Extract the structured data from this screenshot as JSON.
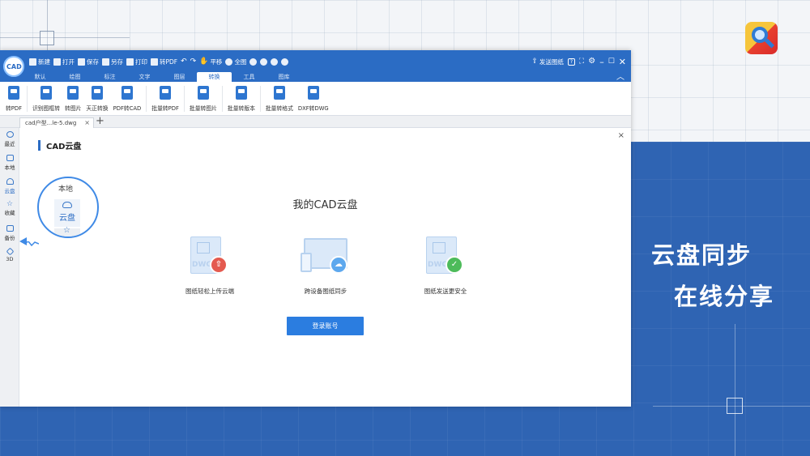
{
  "promo": {
    "line1": "云盘同步",
    "line2": "在线分享"
  },
  "app": {
    "logo_text": "CAD",
    "quick_tools": [
      {
        "icon": "new-file-icon",
        "label": "新建"
      },
      {
        "icon": "open-folder-icon",
        "label": "打开"
      },
      {
        "icon": "save-icon",
        "label": "保存"
      },
      {
        "icon": "save-as-icon",
        "label": "另存"
      },
      {
        "icon": "print-icon",
        "label": "打印"
      },
      {
        "icon": "to-pdf-icon",
        "label": "转PDF"
      },
      {
        "icon": "undo-icon",
        "label": ""
      },
      {
        "icon": "redo-icon",
        "label": ""
      },
      {
        "icon": "pan-hand-icon",
        "label": "平移"
      },
      {
        "icon": "fit-all-icon",
        "label": "全图"
      },
      {
        "icon": "zoom-in-icon",
        "label": ""
      },
      {
        "icon": "zoom-out-icon",
        "label": ""
      },
      {
        "icon": "zoom-window-icon",
        "label": ""
      },
      {
        "icon": "zoom-prev-icon",
        "label": ""
      }
    ],
    "send_drawing_label": "发送图纸",
    "tabs": [
      "默认",
      "绘图",
      "标注",
      "文字",
      "图层",
      "转换",
      "工具",
      "图库"
    ],
    "active_tab": "转换",
    "ribbon": [
      {
        "label": "转PDF",
        "icon": "pdf-export-icon"
      },
      {
        "label": "识别图框转",
        "icon": "frame-detect-icon"
      },
      {
        "label": "转图片",
        "icon": "image-export-icon"
      },
      {
        "label": "天正转换",
        "icon": "tangent-convert-icon"
      },
      {
        "label": "PDF转CAD",
        "icon": "pdf-to-cad-icon"
      },
      {
        "label": "批量转PDF",
        "icon": "batch-pdf-icon"
      },
      {
        "label": "批量转图片",
        "icon": "batch-image-icon"
      },
      {
        "label": "批量转版本",
        "icon": "batch-version-icon"
      },
      {
        "label": "批量转格式",
        "icon": "batch-format-icon"
      },
      {
        "label": "DXF转DWG",
        "icon": "dxf-to-dwg-icon"
      }
    ],
    "doc_tab": "cad户型...le-5.dwg",
    "doc_tab_close": "×",
    "add_tab": "+",
    "sidebar": [
      {
        "label": "最近",
        "icon": "recent-clock-icon"
      },
      {
        "label": "本地",
        "icon": "local-monitor-icon"
      },
      {
        "label": "云盘",
        "icon": "cloud-icon"
      },
      {
        "label": "收藏",
        "icon": "star-icon"
      },
      {
        "label": "备份",
        "icon": "backup-icon"
      },
      {
        "label": "3D",
        "icon": "cube-3d-icon"
      }
    ],
    "panel": {
      "close": "×",
      "title": "CAD云盘",
      "heading": "我的CAD云盘",
      "features": [
        {
          "label": "图纸轻松上传云端",
          "badge_icon": "upload-cloud-icon",
          "doc_text": "DWG"
        },
        {
          "label": "跨设备图纸同步",
          "badge_icon": "sync-cloud-icon",
          "doc_text": ""
        },
        {
          "label": "图纸发送更安全",
          "badge_icon": "shield-check-icon",
          "doc_text": "DWG"
        }
      ],
      "login_button": "登录账号"
    },
    "magnifier": {
      "above_label": "本地",
      "item_label": "云盘"
    }
  },
  "colors": {
    "brand_blue": "#2b6cc4",
    "promo_blue": "#2f64b3",
    "button_blue": "#2b7de0",
    "badge_red": "#e45a4f",
    "badge_green": "#4dbb5a"
  }
}
